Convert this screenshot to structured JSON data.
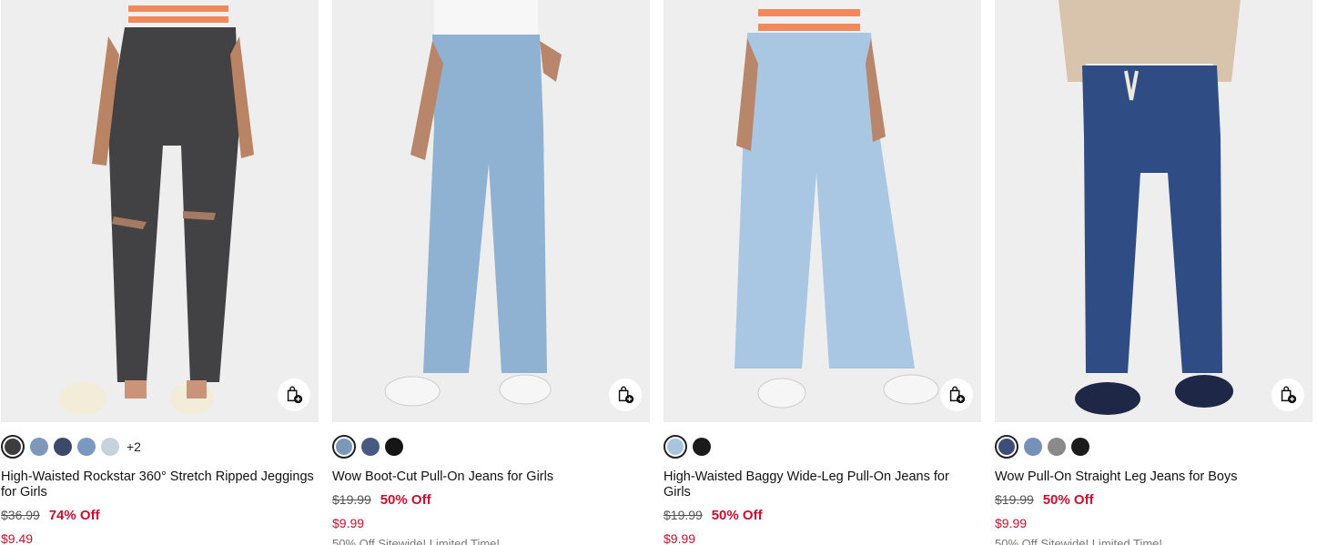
{
  "products": [
    {
      "name": "High-Waisted Rockstar 360° Stretch Ripped Jeggings for Girls",
      "swatches": [
        "#3d3d3f",
        "#7f98b8",
        "#3b4a6a",
        "#7b98c0",
        "#c6d3dc"
      ],
      "more_colors": "+2",
      "original_price": "$36.99",
      "discount": "74% Off",
      "sale_price": "$9.49",
      "promo": ""
    },
    {
      "name": "Wow Boot-Cut Pull-On Jeans for Girls",
      "swatches": [
        "#7c98b8",
        "#465a82",
        "#151515"
      ],
      "more_colors": "",
      "original_price": "$19.99",
      "discount": "50% Off",
      "sale_price": "$9.99",
      "promo": "50% Off Sitewide! Limited Time!"
    },
    {
      "name": "High-Waisted Baggy Wide-Leg Pull-On Jeans for Girls",
      "swatches": [
        "#a9c4e0",
        "#1b1b1b"
      ],
      "more_colors": "",
      "original_price": "$19.99",
      "discount": "50% Off",
      "sale_price": "$9.99",
      "promo": ""
    },
    {
      "name": "Wow Pull-On Straight Leg Jeans for Boys",
      "swatches": [
        "#3e4d78",
        "#7591b8",
        "#8a8a8a",
        "#1b1b1b"
      ],
      "more_colors": "",
      "original_price": "$19.99",
      "discount": "50% Off",
      "sale_price": "$9.99",
      "promo": "50% Off Sitewide! Limited Time!"
    }
  ],
  "icons": {
    "quick_add": "shopping-bag-plus-icon"
  },
  "colors": {
    "sale_red": "#c8102e",
    "photo_bg": "#ededed"
  }
}
